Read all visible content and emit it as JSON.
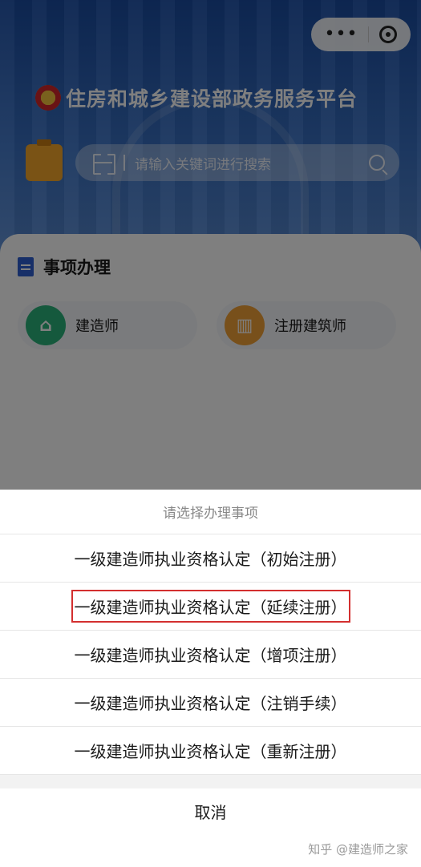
{
  "header": {
    "app_title": "住房和城乡建设部政务服务平台",
    "search_placeholder": "请输入关键词进行搜索"
  },
  "section": {
    "title": "事项办理",
    "services": [
      {
        "label": "建造师",
        "icon": "building-icon",
        "color": "#2bb37a"
      },
      {
        "label": "注册建筑师",
        "icon": "office-building-icon",
        "color": "#f0a037"
      }
    ]
  },
  "action_sheet": {
    "title": "请选择办理事项",
    "options": [
      "一级建造师执业资格认定（初始注册）",
      "一级建造师执业资格认定（延续注册）",
      "一级建造师执业资格认定（增项注册）",
      "一级建造师执业资格认定（注销手续）",
      "一级建造师执业资格认定（重新注册）"
    ],
    "highlighted_option_index": 1,
    "highlight_color": "#d32f2f",
    "cancel_label": "取消"
  },
  "watermark": "知乎 @建造师之家"
}
